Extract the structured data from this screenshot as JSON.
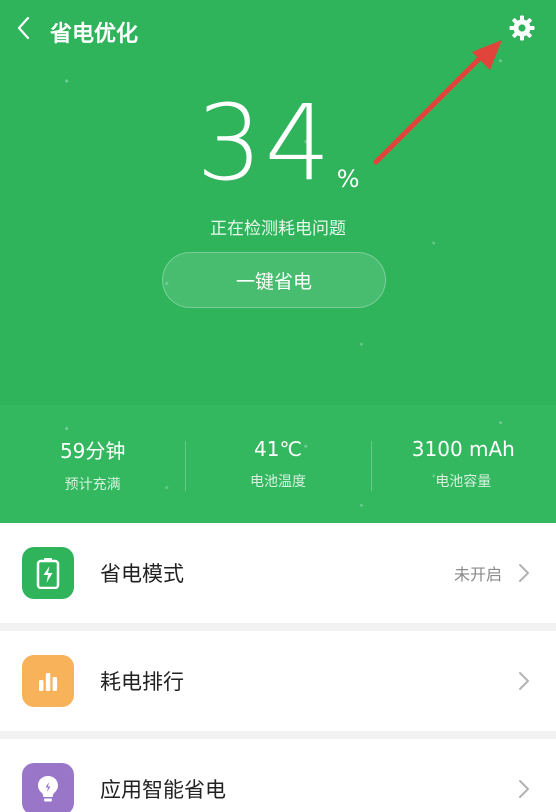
{
  "header": {
    "title": "省电优化",
    "back_icon": "chevron-left-icon",
    "settings_icon": "gear-icon"
  },
  "battery": {
    "percent": "34",
    "unit": "%",
    "status": "正在检测耗电问题",
    "optimize_label": "一键省电"
  },
  "stats": [
    {
      "value": "59分钟",
      "label": "预计充满"
    },
    {
      "value": "41℃",
      "label": "电池温度"
    },
    {
      "value": "3100 mAh",
      "label": "电池容量"
    }
  ],
  "list": [
    {
      "label": "省电模式",
      "status": "未开启",
      "icon": "battery-charging-icon",
      "color": "#2fb45c"
    },
    {
      "label": "耗电排行",
      "status": "",
      "icon": "bar-chart-icon",
      "color": "#f7b25a"
    },
    {
      "label": "应用智能省电",
      "status": "",
      "icon": "lightbulb-icon",
      "color": "#9a76c9"
    }
  ],
  "colors": {
    "primary_green": "#2fb45c",
    "annotation_arrow": "#e0443a"
  }
}
